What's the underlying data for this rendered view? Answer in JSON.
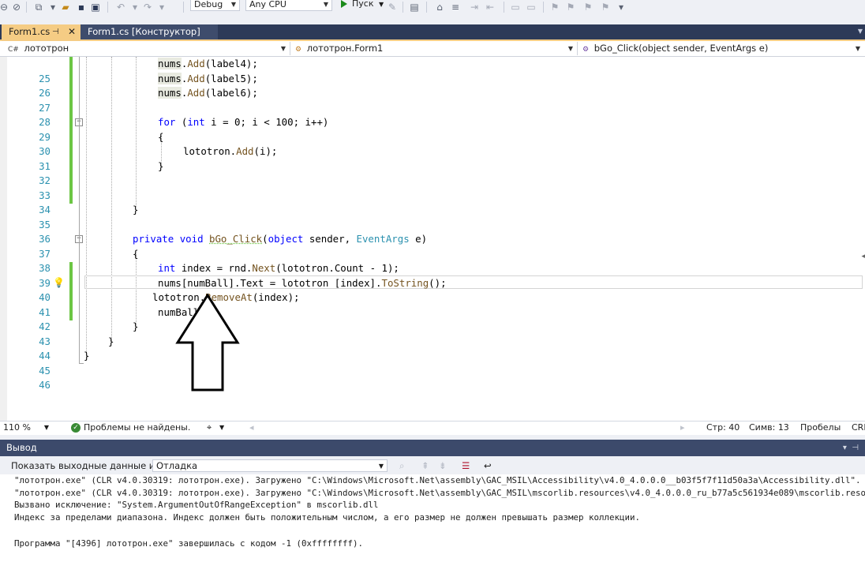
{
  "toolbar": {
    "config": "Debug",
    "platform": "Any CPU",
    "run_label": "Пуск"
  },
  "tabs": [
    {
      "label": "Form1.cs",
      "active": true
    },
    {
      "label": "Form1.cs [Конструктор]",
      "active": false
    }
  ],
  "navbar": {
    "project": "лототрон",
    "class": "лототрон.Form1",
    "member": "bGo_Click(object sender, EventArgs e)"
  },
  "editor": {
    "lines": [
      {
        "n": "25",
        "code": "nums.Add(label4);"
      },
      {
        "n": "26",
        "code": "nums.Add(label5);"
      },
      {
        "n": "27",
        "code": "nums.Add(label6);"
      },
      {
        "n": "28",
        "code": ""
      },
      {
        "n": "29",
        "code": "for (int i = 0; i < 100; i++)"
      },
      {
        "n": "30",
        "code": "{"
      },
      {
        "n": "31",
        "code": "lototron.Add(i);"
      },
      {
        "n": "32",
        "code": "}"
      },
      {
        "n": "33",
        "code": ""
      },
      {
        "n": "34",
        "code": ""
      },
      {
        "n": "35",
        "code": "}"
      },
      {
        "n": "36",
        "code": ""
      },
      {
        "n": "37",
        "code": "private void bGo_Click(object sender, EventArgs e)"
      },
      {
        "n": "38",
        "code": "{"
      },
      {
        "n": "39",
        "code": "int index = rnd.Next(lototron.Count - 1);"
      },
      {
        "n": "40",
        "code": "nums[numBall].Text = lototron [index].ToString();"
      },
      {
        "n": "41",
        "code": "lototron.RemoveAt(index);"
      },
      {
        "n": "42",
        "code": "numBall++;"
      },
      {
        "n": "43",
        "code": "}"
      },
      {
        "n": "44",
        "code": "}"
      },
      {
        "n": "45",
        "code": "}"
      },
      {
        "n": "46",
        "code": ""
      }
    ]
  },
  "status": {
    "zoom": "110 %",
    "problems": "Проблемы не найдены.",
    "line": "Стр: 40",
    "col": "Симв: 13",
    "spaces": "Пробелы",
    "eol": "CRLF"
  },
  "output": {
    "title": "Вывод",
    "show_from_label": "Показать выходные данные из:",
    "source": "Отладка",
    "lines": [
      "\"лототрон.exe\" (CLR v4.0.30319: лототрон.exe). Загружено \"C:\\Windows\\Microsoft.Net\\assembly\\GAC_MSIL\\Accessibility\\v4.0_4.0.0.0__b03f5f7f11d50a3a\\Accessibility.dll\".",
      "\"лототрон.exe\" (CLR v4.0.30319: лототрон.exe). Загружено \"C:\\Windows\\Microsoft.Net\\assembly\\GAC_MSIL\\mscorlib.resources\\v4.0_4.0.0.0_ru_b77a5c561934e089\\mscorlib.resources.dll\".",
      "Вызвано исключение: \"System.ArgumentOutOfRangeException\" в mscorlib.dll",
      "Индекс за пределами диапазона. Индекс должен быть положительным числом, а его размер не должен превышать размер коллекции.",
      "",
      "Программа \"[4396] лототрон.exe\" завершилась с кодом -1 (0xffffffff)."
    ]
  },
  "colors": {
    "tab_active": "#f5cc84",
    "tab_bar": "#2d3a58",
    "change_bar": "#6cc644",
    "keyword": "#0000ff",
    "type": "#2b91af",
    "method": "#74531f"
  }
}
